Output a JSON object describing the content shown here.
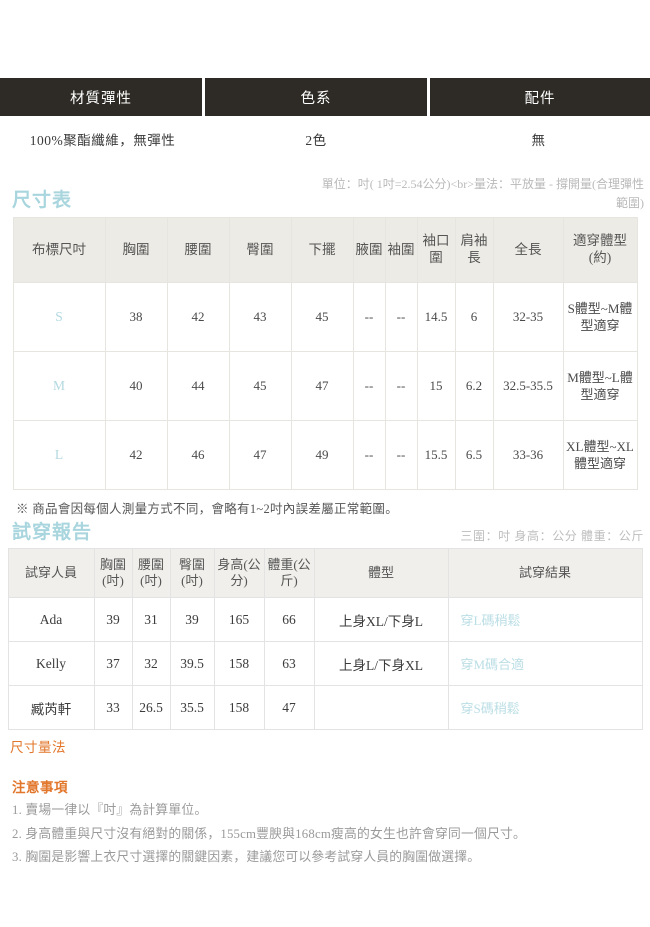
{
  "spec_bar": {
    "headers": [
      "材質彈性",
      "色系",
      "配件"
    ],
    "values": [
      "100%聚酯纖維，無彈性",
      "2色",
      "無"
    ]
  },
  "size_section": {
    "title": "尺寸表",
    "unit_note": "單位：吋( 1吋=2.54公分)<br>量法：平放量 - 撐開量(合理彈性範圍)",
    "columns": [
      "布標尺吋",
      "胸圍",
      "腰圍",
      "臀圍",
      "下擺",
      "腋圍",
      "袖圍",
      "袖口圍",
      "肩袖長",
      "全長",
      "適穿體型(約)"
    ],
    "rows": [
      {
        "size": "S",
        "bust": "38",
        "waist": "42",
        "hip": "43",
        "hem": "45",
        "armpit": "--",
        "sleeve": "--",
        "cuff": "14.5",
        "shoulder_sleeve": "6",
        "length": "32-35",
        "fit": "S體型~M體型適穿"
      },
      {
        "size": "M",
        "bust": "40",
        "waist": "44",
        "hip": "45",
        "hem": "47",
        "armpit": "--",
        "sleeve": "--",
        "cuff": "15",
        "shoulder_sleeve": "6.2",
        "length": "32.5-35.5",
        "fit": "M體型~L體型適穿"
      },
      {
        "size": "L",
        "bust": "42",
        "waist": "46",
        "hip": "47",
        "hem": "49",
        "armpit": "--",
        "sleeve": "--",
        "cuff": "15.5",
        "shoulder_sleeve": "6.5",
        "length": "33-36",
        "fit": "XL體型~XL體型適穿"
      }
    ],
    "footnote": "※ 商品會因每個人測量方式不同，會略有1~2吋內誤差屬正常範圍。"
  },
  "fit_section": {
    "title": "試穿報告",
    "unit_note": "三圍：吋 身高：公分 體重：公斤",
    "columns": [
      "試穿人員",
      "胸圍(吋)",
      "腰圍(吋)",
      "臀圍(吋)",
      "身高(公分)",
      "體重(公斤)",
      "體型",
      "試穿結果"
    ],
    "rows": [
      {
        "name": "Ada",
        "bust": "39",
        "waist": "31",
        "hip": "39",
        "height": "165",
        "weight": "66",
        "shape": "上身XL/下身L",
        "result": "穿L碼稍鬆"
      },
      {
        "name": "Kelly",
        "bust": "37",
        "waist": "32",
        "hip": "39.5",
        "height": "158",
        "weight": "63",
        "shape": "上身L/下身XL",
        "result": "穿M碼合適"
      },
      {
        "name": "臧芮軒",
        "bust": "33",
        "waist": "26.5",
        "hip": "35.5",
        "height": "158",
        "weight": "47",
        "shape": "",
        "result": "穿S碼稍鬆"
      }
    ]
  },
  "measure_section": {
    "title": "尺寸量法"
  },
  "notes_section": {
    "title": "注意事項",
    "items": [
      "1. 賣場一律以『吋』為計算單位。",
      "2. 身高體重與尺寸沒有絕對的關係，155cm豐腴與168cm瘦高的女生也許會穿同一個尺寸。",
      "3. 胸圍是影響上衣尺寸選擇的關鍵因素，建議您可以參考試穿人員的胸圍做選擇。"
    ]
  },
  "colors": {
    "bar_dark": "#2e2b26",
    "accent_cyan": "#a9d6de",
    "accent_orange": "#e2762a",
    "header_beige": "#edebe5"
  }
}
